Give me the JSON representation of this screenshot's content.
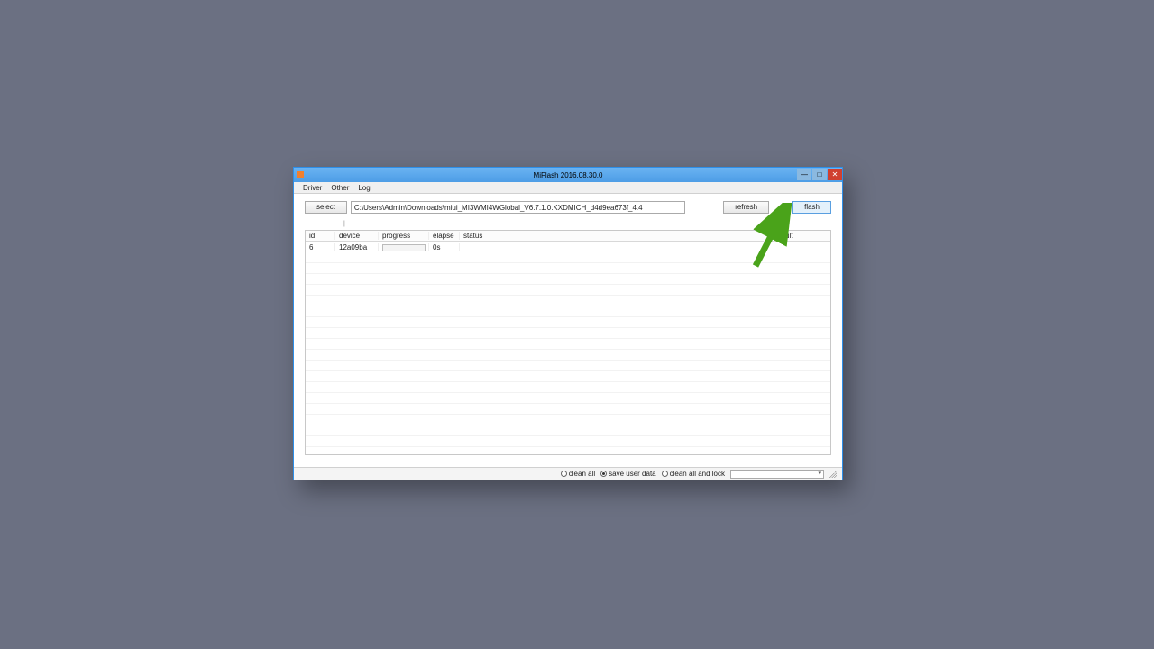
{
  "window": {
    "title": "MiFlash 2016.08.30.0"
  },
  "menu": {
    "driver": "Driver",
    "other": "Other",
    "log": "Log"
  },
  "toolbar": {
    "select_label": "select",
    "path_value": "C:\\Users\\Admin\\Downloads\\miui_MI3WMI4WGlobal_V6.7.1.0.KXDMICH_d4d9ea673f_4.4",
    "refresh_label": "refresh",
    "flash_label": "flash"
  },
  "columns": {
    "id": "id",
    "device": "device",
    "progress": "progress",
    "elapse": "elapse",
    "status": "status",
    "result": "result"
  },
  "rows": [
    {
      "id": "6",
      "device": "12a09ba",
      "elapse": "0s",
      "status": "",
      "result": ""
    }
  ],
  "footer": {
    "clean_all": "clean all",
    "save_user_data": "save user data",
    "clean_all_and_lock": "clean all and lock",
    "selected_option": "save_user_data"
  }
}
